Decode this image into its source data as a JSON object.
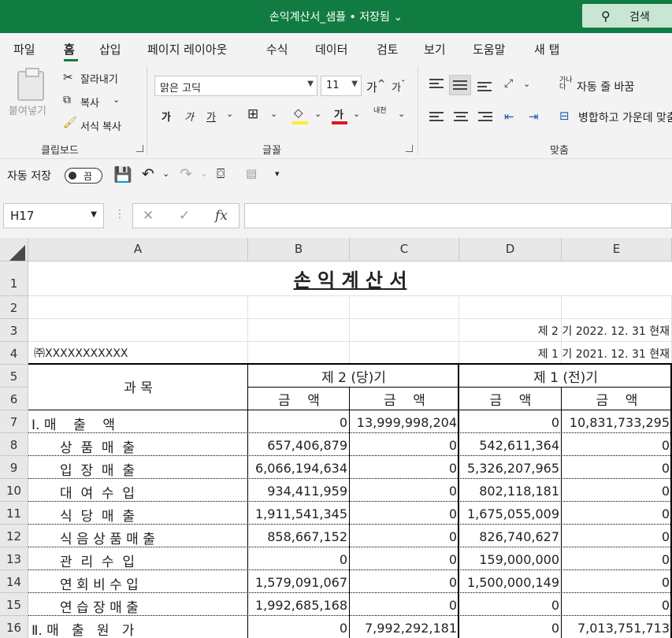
{
  "window": {
    "title": "손익계산서_샘플 • 저장됨",
    "search_label": "검색"
  },
  "tabs": [
    "파일",
    "홈",
    "삽입",
    "페이지 레이아웃",
    "수식",
    "데이터",
    "검토",
    "보기",
    "도움말",
    "새 탭"
  ],
  "ribbon": {
    "paste": "붙여넣기",
    "cut": "잘라내기",
    "copy": "복사",
    "format_painter": "서식 복사",
    "clipboard_group": "클립보드",
    "font_name": "맑은 고딕",
    "font_size": "11",
    "grow_font": "가",
    "shrink_font": "가",
    "bold": "가",
    "italic": "가",
    "underline": "가",
    "font_color": "가",
    "phonetic": "내천",
    "font_group": "글꼴",
    "wrap_text": "자동 줄 바꿈",
    "merge_center": "병합하고 가운데 맞춤",
    "alignment_group": "맞춤",
    "colors": {
      "fill": "#ffeb3b",
      "font": "#e81123",
      "accent": "#107c41"
    }
  },
  "qat": {
    "autosave": "자동 저장",
    "autosave_state": "끔"
  },
  "formula_bar": {
    "name_box": "H17",
    "formula": ""
  },
  "columns": [
    "A",
    "B",
    "C",
    "D",
    "E"
  ],
  "rows": [
    "1",
    "2",
    "3",
    "4",
    "5",
    "6",
    "7",
    "8",
    "9",
    "10",
    "11",
    "12",
    "13",
    "14",
    "15",
    "16"
  ],
  "sheet": {
    "title": "손 익 계 산 서",
    "period_current": "제 2 기 2022.  12.  31 현재",
    "period_prior": "제 1 기 2021.  12.  31 현재",
    "company": "㈜XXXXXXXXXXX",
    "header_account": "과 목",
    "header_current": "제 2 (당)기",
    "header_prior": "제 1 (전)기",
    "header_amount": "금    액",
    "items": [
      {
        "label": "Ⅰ. 매    출    액",
        "b": "0",
        "c": "13,999,998,204",
        "d": "0",
        "e": "10,831,733,295"
      },
      {
        "label": "상  품  매  출",
        "b": "657,406,879",
        "c": "0",
        "d": "542,611,364",
        "e": "0"
      },
      {
        "label": "입  장  매  출",
        "b": "6,066,194,634",
        "c": "0",
        "d": "5,326,207,965",
        "e": "0"
      },
      {
        "label": "대  여  수  입",
        "b": "934,411,959",
        "c": "0",
        "d": "802,118,181",
        "e": "0"
      },
      {
        "label": "식  당  매  출",
        "b": "1,911,541,345",
        "c": "0",
        "d": "1,675,055,009",
        "e": "0"
      },
      {
        "label": "식 음 상 품 매 출",
        "b": "858,667,152",
        "c": "0",
        "d": "826,740,627",
        "e": "0"
      },
      {
        "label": "관  리  수  입",
        "b": "0",
        "c": "0",
        "d": "159,000,000",
        "e": "0"
      },
      {
        "label": "연 회 비 수 입",
        "b": "1,579,091,067",
        "c": "0",
        "d": "1,500,000,149",
        "e": "0"
      },
      {
        "label": "연 습 장 매 출",
        "b": "1,992,685,168",
        "c": "0",
        "d": "0",
        "e": "0"
      },
      {
        "label": "Ⅱ. 매   출   원   가",
        "b": "0",
        "c": "7,992,292,181",
        "d": "0",
        "e": "7,013,751,713"
      }
    ]
  }
}
